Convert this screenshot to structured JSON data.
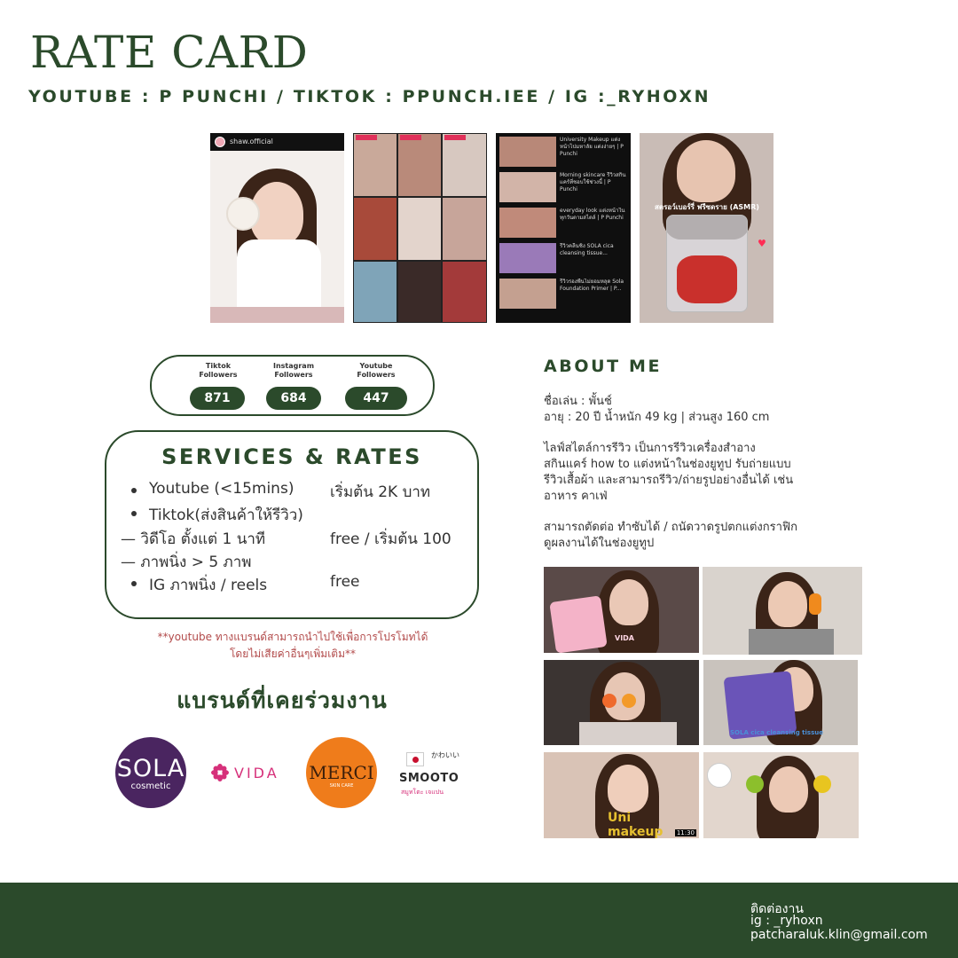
{
  "header": {
    "title": "RATE CARD",
    "subtitle": "YOUTUBE : P PUNCHI / TIKTOK : PPUNCH.IEE / IG :_RYHOXN"
  },
  "gallery": {
    "shot1_account": "shaw.official",
    "shot3_items": [
      "University Makeup แต่งหน้าไปมหาลัย แต่งง่ายๆ | P Punchi",
      "Morning skincare รีวิวสกินแคร์ที่ชอบใช้ช่วงนี้ | P Punchi",
      "everyday look แต่งหน้าในทุกวันตามสไตล์ | P Punchi",
      "รีวิวคลีนซิ่ง SOLA cica cleansing tissue...",
      "รีวิวรองพื้นไม่ยอมหลุด Sola Foundation Primer | P..."
    ],
    "shot4_caption": "สตรอว์เบอร์รี่ ฟรีซดราย (ASMR)"
  },
  "followers": [
    {
      "label_line1": "Tiktok",
      "label_line2": "Followers",
      "value": "871"
    },
    {
      "label_line1": "Instagram",
      "label_line2": "Followers",
      "value": "684"
    },
    {
      "label_line1": "Youtube",
      "label_line2": "Followers",
      "value": "447"
    }
  ],
  "services": {
    "title": "SERVICES & RATES",
    "rows": [
      {
        "item": "Youtube (<15mins)",
        "rate": "เริ่มต้น 2K บาท",
        "style": "bullet"
      },
      {
        "item": "Tiktok(ส่งสินค้าให้รีวิว)",
        "rate": "",
        "style": "bullet"
      },
      {
        "item": "— วิดีโอ ตั้งแต่ 1 นาที",
        "rate": "free / เริ่มต้น 100",
        "style": "dash"
      },
      {
        "item": "— ภาพนิ่ง > 5 ภาพ",
        "rate": "",
        "style": "dash"
      },
      {
        "item": "IG ภาพนิ่ง / reels",
        "rate": "free",
        "style": "bullet"
      }
    ]
  },
  "note": {
    "line1": "**youtube ทางแบรนด์สามารถนำไปใช้เพื่อการโปรโมทได้",
    "line2": "โดยไม่เสียค่าอื่นๆเพิ่มเติม**"
  },
  "brands": {
    "heading": "แบรนด์ที่เคยร่วมงาน",
    "sola_big": "SOLA",
    "sola_small": "cosmetic",
    "vida": "VIDA",
    "merci_big": "MERCI",
    "merci_small": "SKIN CARE",
    "smooto_kana": "かわいい",
    "smooto_name": "SMOOTO",
    "smooto_thai": "สมูทโตะ เจแปน"
  },
  "about": {
    "heading": "ABOUT ME",
    "lines": [
      "ชื่อเล่น : พั้นช์",
      "อายุ : 20 ปี น้ำหนัก 49 kg | ส่วนสูง 160 cm",
      "ไลฟ์สไตล์การรีวิว เป็นการรีวิวเครื่องสำอาง",
      "สกินแคร์ how to แต่งหน้าในช่องยูทูป รับถ่ายแบบ",
      "รีวิวเสื้อผ้า และสามารถรีวิว/ถ่ายรูปอย่างอื่นได้ เช่น",
      "อาหาร คาเฟ่",
      "สามารถตัดต่อ ทำซับได้ / ถนัดวาดรูปตกแต่งกราฟิก",
      "ดูผลงานได้ในช่องยูทูป"
    ]
  },
  "thumbnails": {
    "t1_text": "VIDA",
    "t4_text": "SOLA cica cleansing tissue",
    "t5_text": "Uni makeup",
    "t5_time": "11:30"
  },
  "footer": {
    "line1": "ติดต่องาน",
    "line2": "ig : _ryhoxn",
    "line3": "patcharaluk.klin@gmail.com"
  },
  "colors": {
    "brand_green": "#2b4a2b",
    "note_red": "#b24a4a",
    "sola_purple": "#4a2560",
    "merci_orange": "#ef7c1b",
    "vida_pink": "#d6307a"
  }
}
